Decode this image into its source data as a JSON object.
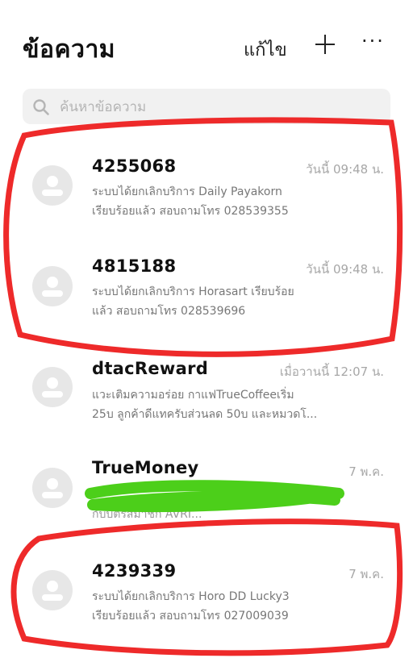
{
  "header": {
    "title": "ข้อความ",
    "edit_label": "แก้ไข",
    "add_icon": "plus-icon",
    "more_label": "···"
  },
  "search": {
    "placeholder": "ค้นหาข้อความ",
    "icon": "search-icon"
  },
  "messages": [
    {
      "sender": "4255068",
      "time": "วันนี้ 09:48 น.",
      "preview_line1": "ระบบได้ยกเลิกบริการ Daily Payakorn",
      "preview_line2": "เรียบร้อยแล้ว สอบถามโทร 028539355"
    },
    {
      "sender": "4815188",
      "time": "วันนี้ 09:48 น.",
      "preview_line1": "ระบบได้ยกเลิกบริการ Horasart เรียบร้อย",
      "preview_line2": "แล้ว สอบถามโทร 028539696"
    },
    {
      "sender": "dtacReward",
      "time": "เมื่อวานนี้ 12:07 น.",
      "preview_line1": "แวะเติมความอร่อย กาแฟTrueCoffeeเริ่ม",
      "preview_line2": "25บ ลูกค้าดีแทครับส่วนลด 50บ และหมวดโ..."
    },
    {
      "sender": "TrueMoney",
      "time": "7 พ.ค.",
      "preview_line1": "",
      "preview_line2": "กับบัตรสมาชิก AVRI..."
    },
    {
      "sender": "4239339",
      "time": "7 พ.ค.",
      "preview_line1": "ระบบได้ยกเลิกบริการ Horo DD Lucky3",
      "preview_line2": "เรียบร้อยแล้ว สอบถามโทร 027009039"
    }
  ],
  "colors": {
    "annotation_red": "#ee2a2a",
    "annotation_green": "#4ccf1a",
    "avatar_bg": "#e7e7e7",
    "meta_text": "#a7a7a7"
  }
}
